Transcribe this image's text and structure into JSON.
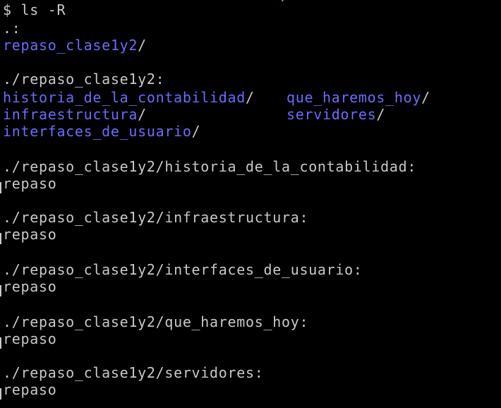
{
  "terminal": {
    "top_fragment": ", ...),",
    "prompt": "$ ls -R",
    "root_header": ".:",
    "root_entry": "repaso_clase1y2",
    "sub_header": "./repaso_clase1y2:",
    "listing": {
      "col1": [
        "historia_de_la_contabilidad",
        "infraestructura",
        "interfaces_de_usuario"
      ],
      "col2": [
        "que_haremos_hoy",
        "servidores"
      ]
    },
    "sections": [
      {
        "header": "./repaso_clase1y2/historia_de_la_contabilidad:",
        "content": "repaso"
      },
      {
        "header": "./repaso_clase1y2/infraestructura:",
        "content": "repaso"
      },
      {
        "header": "./repaso_clase1y2/interfaces_de_usuario:",
        "content": "repaso"
      },
      {
        "header": "./repaso_clase1y2/que_haremos_hoy:",
        "content": "repaso"
      },
      {
        "header": "./repaso_clase1y2/servidores:",
        "content": "repaso"
      }
    ],
    "slash": "/",
    "colors": {
      "background": "#000000",
      "text": "#c8c8c8",
      "directory": "#6b6bff"
    }
  }
}
